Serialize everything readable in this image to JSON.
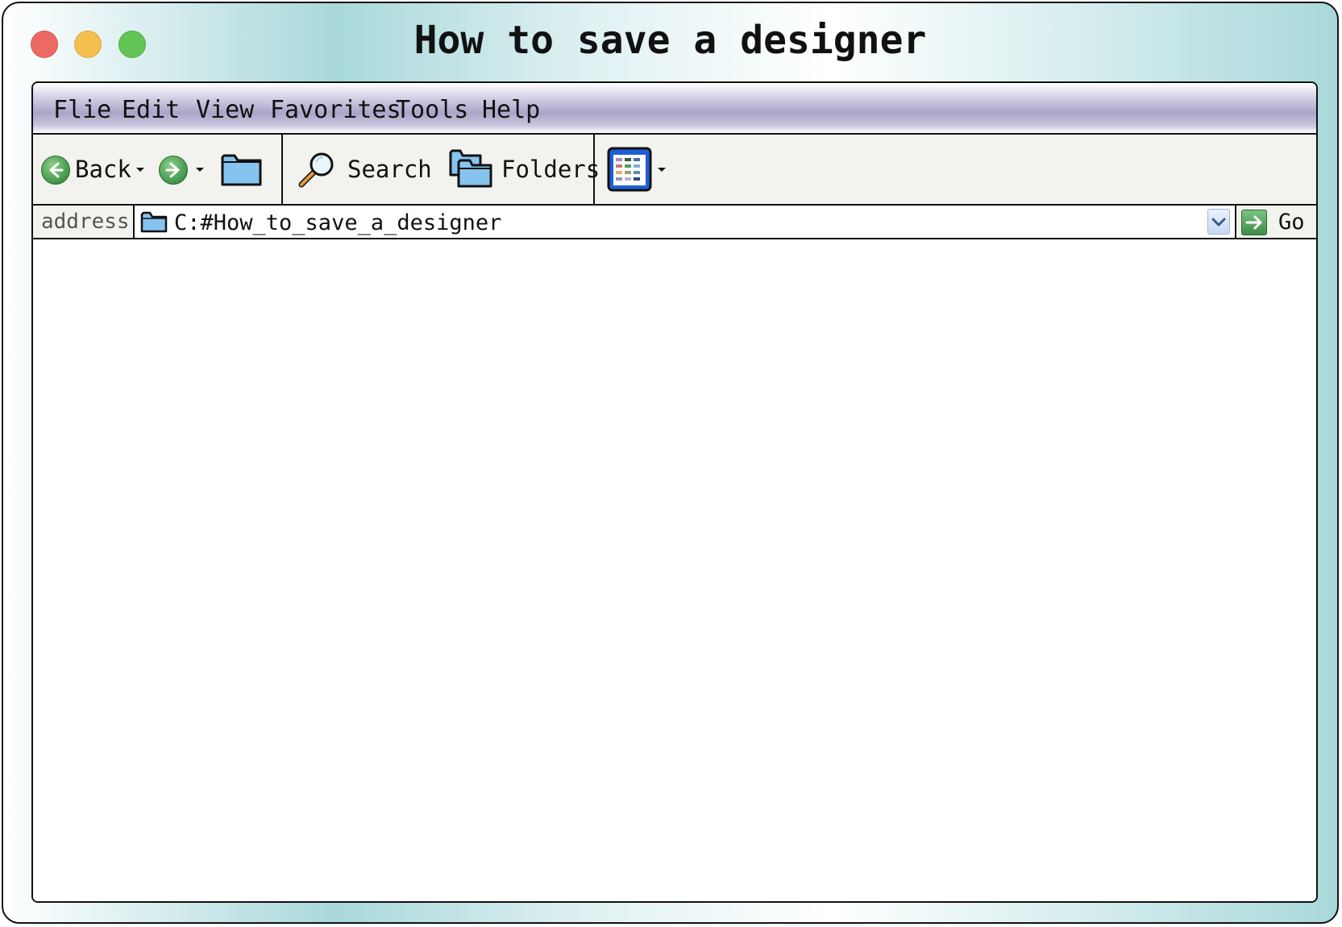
{
  "window": {
    "title": "How to save a designer"
  },
  "menu": {
    "items": [
      "Flie",
      "Edit",
      "View",
      "Favorites",
      "Tools",
      "Help"
    ]
  },
  "toolbar": {
    "back_label": "Back",
    "search_label": "Search",
    "folders_label": "Folders"
  },
  "address": {
    "label": "address",
    "path": "C:#How_to_save_a_designer",
    "go_label": "Go"
  },
  "colors": {
    "close": "#ec6a63",
    "minimize": "#f5bf4f",
    "maximize": "#61c454",
    "frame_accent": "#a9d8db",
    "menubar_accent": "#a9a5c8"
  },
  "icons": {
    "back": "arrow-left-icon",
    "forward": "arrow-right-icon",
    "up_folder": "folder-icon",
    "search": "magnifier-icon",
    "folders": "folders-icon",
    "views": "views-icon",
    "go": "go-arrow-icon"
  }
}
